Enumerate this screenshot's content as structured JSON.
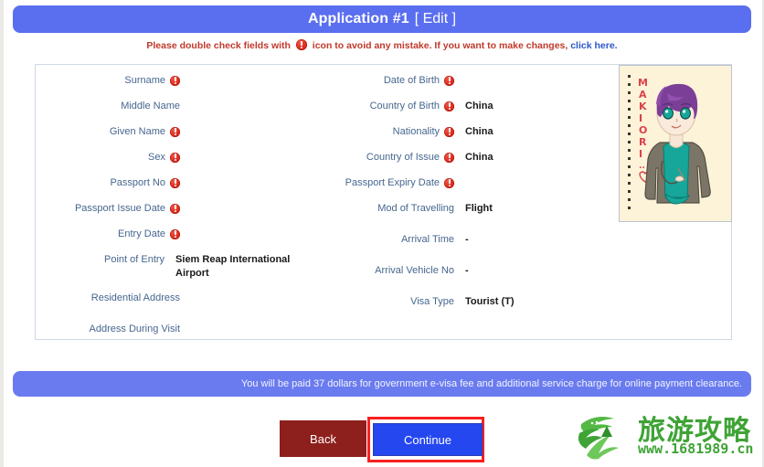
{
  "colors": {
    "banner_blue": "#5a6ef0",
    "footer_blue": "#6a7bef",
    "label_blue": "#46668f",
    "notice_red": "#c0392b",
    "link_blue": "#2b56c6",
    "back_red": "#8d1f1c",
    "continue_blue": "#2547f0",
    "highlight_red": "#fa2020",
    "watermark_green": "#3fa336"
  },
  "header": {
    "title": "Application #1",
    "edit_label": "[ Edit ]"
  },
  "notice": {
    "text_before": "Please double check fields with",
    "icon": "warning-exclamation-icon",
    "text_after": "icon to avoid any mistake. If you want to make changes,",
    "link_label": "click here."
  },
  "form": {
    "left_column": [
      {
        "label": "Surname",
        "has_warning": true,
        "value": ""
      },
      {
        "label": "Middle Name",
        "has_warning": false,
        "value": ""
      },
      {
        "label": "Given Name",
        "has_warning": true,
        "value": ""
      },
      {
        "label": "Sex",
        "has_warning": true,
        "value": ""
      },
      {
        "label": "Passport No",
        "has_warning": true,
        "value": ""
      },
      {
        "label": "Passport Issue Date",
        "has_warning": true,
        "value": ""
      },
      {
        "label": "Entry Date",
        "has_warning": true,
        "value": ""
      },
      {
        "label": "Point of Entry",
        "has_warning": false,
        "value": "Siem Reap International Airport"
      },
      {
        "label": "Residential Address",
        "has_warning": false,
        "value": ""
      },
      {
        "label": "Address During Visit",
        "has_warning": false,
        "value": ""
      }
    ],
    "right_column": [
      {
        "label": "Date of Birth",
        "has_warning": true,
        "value": ""
      },
      {
        "label": "Country of Birth",
        "has_warning": true,
        "value": "China"
      },
      {
        "label": "Nationality",
        "has_warning": true,
        "value": "China"
      },
      {
        "label": "Country of Issue",
        "has_warning": true,
        "value": "China"
      },
      {
        "label": "Passport Expiry Date",
        "has_warning": true,
        "value": ""
      },
      {
        "label": "Mod of Travelling",
        "has_warning": false,
        "value": "Flight"
      },
      {
        "label": "Arrival Time",
        "has_warning": false,
        "value": "-"
      },
      {
        "label": "Arrival Vehicle No",
        "has_warning": false,
        "value": "-"
      },
      {
        "label": "Visa Type",
        "has_warning": false,
        "value": "Tourist (T)"
      }
    ]
  },
  "photo": {
    "alt_name": "applicant-photo",
    "caption_text": "MAKIORI",
    "caption_color": "#d8434b",
    "paper_color": "#fdf3d8",
    "hair_color": "#7b3f98",
    "shirt_color": "#16a79a",
    "jacket_color": "#7a7566",
    "skin_color": "#f7e6d5"
  },
  "footer": {
    "notice": "You will be paid 37 dollars for government e-visa fee and additional service charge for online payment clearance."
  },
  "buttons": {
    "back_label": "Back",
    "continue_label": "Continue"
  },
  "watermark": {
    "chinese_text": "旅游攻略",
    "url_text": "www.1681989.cn"
  }
}
